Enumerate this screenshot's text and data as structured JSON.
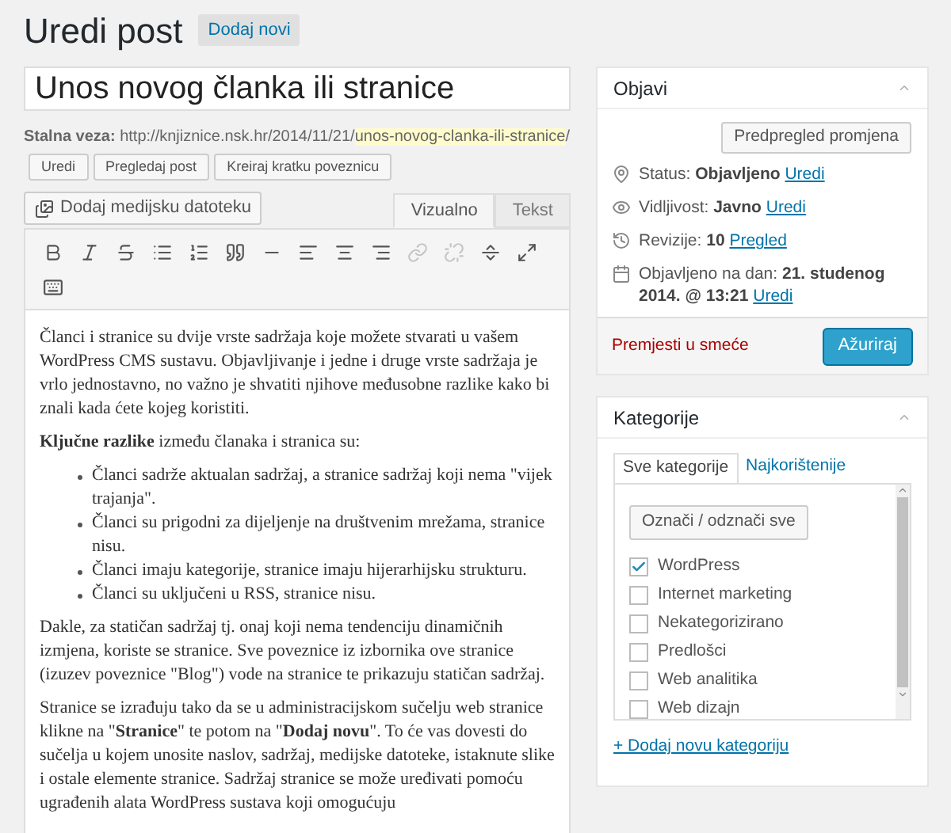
{
  "header": {
    "title": "Uredi post",
    "add_new": "Dodaj novi"
  },
  "post_title": "Unos novog članka ili stranice",
  "permalink": {
    "label": "Stalna veza:",
    "base": "http://knjiznice.nsk.hr/2014/11/21/",
    "slug": "unos-novog-clanka-ili-stranice",
    "suffix": "/",
    "buttons": [
      "Uredi",
      "Pregledaj post",
      "Kreiraj kratku poveznicu"
    ]
  },
  "media_button": "Dodaj medijsku datoteku",
  "editor_tabs": [
    {
      "label": "Vizualno",
      "selected": true
    },
    {
      "label": "Tekst",
      "selected": false
    }
  ],
  "toolbar": [
    {
      "kind": "bold",
      "disabled": false
    },
    {
      "kind": "italic",
      "disabled": false
    },
    {
      "kind": "strike",
      "disabled": false
    },
    {
      "kind": "bullets",
      "disabled": false
    },
    {
      "kind": "numbers",
      "disabled": false
    },
    {
      "kind": "quote",
      "disabled": false
    },
    {
      "kind": "rule",
      "disabled": false
    },
    {
      "kind": "align-left",
      "disabled": false
    },
    {
      "kind": "align-center",
      "disabled": false
    },
    {
      "kind": "align-right",
      "disabled": false
    },
    {
      "kind": "link",
      "disabled": true
    },
    {
      "kind": "unlink",
      "disabled": true
    },
    {
      "kind": "more",
      "disabled": false
    },
    {
      "kind": "fullscreen",
      "disabled": false
    },
    {
      "kind": "kitchen-sink",
      "disabled": false
    }
  ],
  "content": [
    {
      "kind": "paragraph",
      "text": "Članci i stranice su dvije vrste sadržaja koje možete stvarati u vašem WordPress CMS sustavu. Objavljivanje i jedne i druge vrste sadržaja je vrlo jednostavno, no važno je shvatiti njihove međusobne razlike kako bi znali kada ćete kojeg koristiti."
    },
    {
      "kind": "paragraph",
      "text": "**Ključne razlike** između članaka i stranica su:"
    },
    {
      "kind": "list",
      "items": [
        "Članci sadrže aktualan sadržaj, a stranice sadržaj koji nema \"vijek trajanja\".",
        "Članci su prigodni za dijeljenje na društvenim mrežama, stranice nisu.",
        "Članci imaju kategorije, stranice imaju hijerarhijsku strukturu.",
        "Članci su uključeni u RSS, stranice nisu."
      ]
    },
    {
      "kind": "paragraph",
      "text": "Dakle, za statičan sadržaj tj. onaj koji nema tendenciju dinamičnih izmjena, koriste se stranice.  Sve poveznice iz izbornika ove stranice (izuzev poveznice \"Blog\") vode na stranice te prikazuju statičan sadržaj."
    },
    {
      "kind": "paragraph",
      "text": "Stranice se izrađuju tako da se u administracijskom sučelju web stranice klikne na \"**Stranice**\" te potom na \"**Dodaj novu**\". To će vas dovesti do sučelja u kojem unosite naslov, sadržaj, medijske datoteke, istaknute slike i ostale elemente stranice. Sadržaj stranice se može uređivati pomoću ugrađenih alata WordPress sustava koji omogućuju"
    }
  ],
  "publish": {
    "title": "Objavi",
    "preview": "Predpregled promjena",
    "rows": [
      {
        "kind": "status",
        "label": "Status:",
        "value": "Objavljeno",
        "link": "Uredi"
      },
      {
        "kind": "visibility",
        "label": "Vidljivost:",
        "value": "Javno",
        "link": "Uredi"
      },
      {
        "kind": "revisions",
        "label": "Revizije:",
        "value": "10",
        "link": "Pregled"
      },
      {
        "kind": "date",
        "label": "Objavljeno na dan:",
        "value": "21. studenog 2014. @ 13:21",
        "link": "Uredi"
      }
    ],
    "trash": "Premjesti u smeće",
    "update": "Ažuriraj"
  },
  "categories": {
    "title": "Kategorije",
    "tabs": [
      {
        "label": "Sve kategorije",
        "selected": true
      },
      {
        "label": "Najkorištenije",
        "selected": false
      }
    ],
    "toggle_all": "Označi / odznači sve",
    "items": [
      {
        "label": "WordPress",
        "checked": true
      },
      {
        "label": "Internet marketing",
        "checked": false
      },
      {
        "label": "Nekategorizirano",
        "checked": false
      },
      {
        "label": "Predlošci",
        "checked": false
      },
      {
        "label": "Web analitika",
        "checked": false
      },
      {
        "label": "Web dizajn",
        "checked": false
      }
    ],
    "add_link": "+ Dodaj novu kategoriju"
  }
}
